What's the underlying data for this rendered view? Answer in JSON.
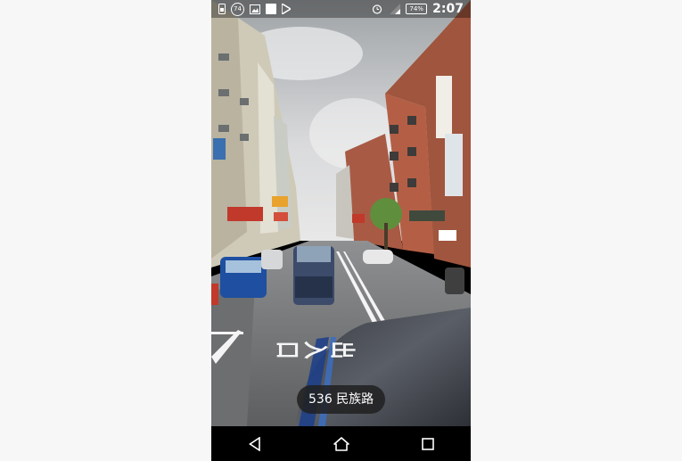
{
  "status_bar": {
    "left_icons": [
      "sim-icon",
      "notification-74-icon",
      "gallery-icon",
      "blank-square-icon",
      "play-store-icon"
    ],
    "notification_count": "74",
    "battery_level": "74%",
    "time": "2:07"
  },
  "street_view": {
    "road_marking": "出入口",
    "address_label": "536 民族路"
  },
  "nav_bar": {
    "buttons": [
      "back-icon",
      "home-icon",
      "recents-icon"
    ]
  },
  "colors": {
    "nav_bar": "#000000",
    "address_chip": "#202020",
    "page_background": "#f7f7f7"
  }
}
